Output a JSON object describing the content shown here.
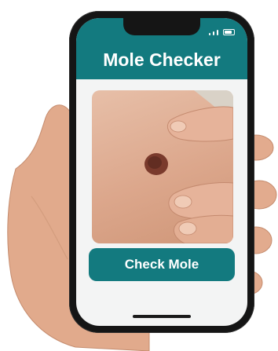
{
  "app": {
    "title": "Mole Checker",
    "check_button_label": "Check Mole"
  },
  "status_bar": {
    "icons": [
      "signal-icon",
      "battery-icon"
    ]
  },
  "colors": {
    "accent": "#137a7f",
    "screen_bg": "#f3f4f4",
    "phone_body": "#151515",
    "skin": "#d9a287",
    "mole": "#6b2f24"
  }
}
